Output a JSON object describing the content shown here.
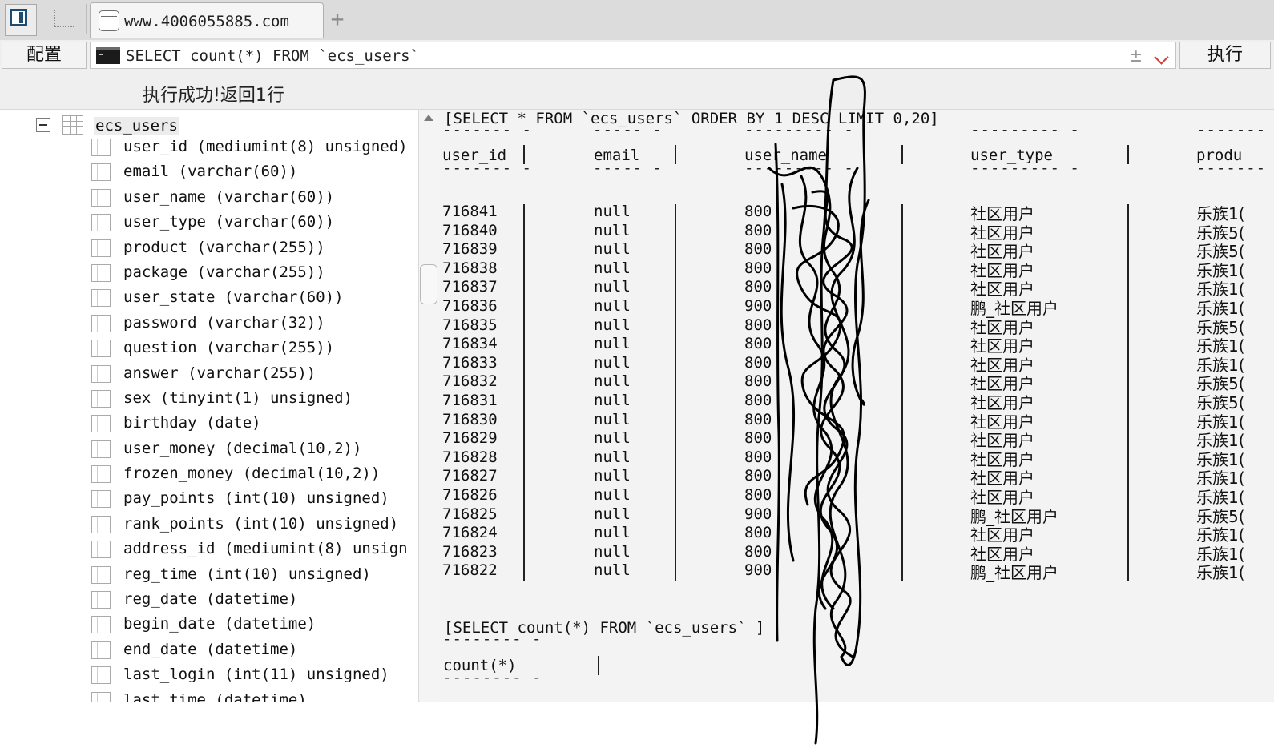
{
  "tabbar": {
    "tab_title": "www.4006055885.com",
    "add_tab": "+"
  },
  "querybar": {
    "config_label": "配置",
    "sql_text": "SELECT count(*) FROM `ecs_users`",
    "plus_minus": "±",
    "exec_label": "执行"
  },
  "status": {
    "message": "执行成功!返回1行"
  },
  "tree": {
    "table_name": "ecs_users",
    "columns": [
      "user_id (mediumint(8) unsigned)",
      "email (varchar(60))",
      "user_name (varchar(60))",
      "user_type (varchar(60))",
      "product (varchar(255))",
      "package (varchar(255))",
      "user_state (varchar(60))",
      "password (varchar(32))",
      "question (varchar(255))",
      "answer (varchar(255))",
      "sex (tinyint(1) unsigned)",
      "birthday (date)",
      "user_money (decimal(10,2))",
      "frozen_money (decimal(10,2))",
      "pay_points (int(10) unsigned)",
      "rank_points (int(10) unsigned)",
      "address_id (mediumint(8) unsign",
      "reg_time (int(10) unsigned)",
      "reg_date (datetime)",
      "begin_date (datetime)",
      "end_date (datetime)",
      "last_login (int(11) unsigned)",
      "last_time (datetime)"
    ]
  },
  "results": {
    "query1": "[SELECT * FROM `ecs_users` ORDER BY 1 DESC LIMIT 0,20]",
    "headers": [
      "user_id",
      "email",
      "user_name",
      "user_type",
      "produ"
    ],
    "rows": [
      {
        "user_id": "716841",
        "email": "null",
        "user_name": "800",
        "user_type": "社区用户",
        "product": "乐族1("
      },
      {
        "user_id": "716840",
        "email": "null",
        "user_name": "800",
        "user_type": "社区用户",
        "product": "乐族5("
      },
      {
        "user_id": "716839",
        "email": "null",
        "user_name": "800",
        "user_type": "社区用户",
        "product": "乐族5("
      },
      {
        "user_id": "716838",
        "email": "null",
        "user_name": "800",
        "user_type": "社区用户",
        "product": "乐族1("
      },
      {
        "user_id": "716837",
        "email": "null",
        "user_name": "800",
        "user_type": "社区用户",
        "product": "乐族1("
      },
      {
        "user_id": "716836",
        "email": "null",
        "user_name": "900",
        "user_type": "鹏_社区用户",
        "product": "乐族1("
      },
      {
        "user_id": "716835",
        "email": "null",
        "user_name": "800",
        "user_type": "社区用户",
        "product": "乐族5("
      },
      {
        "user_id": "716834",
        "email": "null",
        "user_name": "800",
        "user_type": "社区用户",
        "product": "乐族1("
      },
      {
        "user_id": "716833",
        "email": "null",
        "user_name": "800",
        "user_type": "社区用户",
        "product": "乐族1("
      },
      {
        "user_id": "716832",
        "email": "null",
        "user_name": "800",
        "user_type": "社区用户",
        "product": "乐族5("
      },
      {
        "user_id": "716831",
        "email": "null",
        "user_name": "800",
        "user_type": "社区用户",
        "product": "乐族5("
      },
      {
        "user_id": "716830",
        "email": "null",
        "user_name": "800",
        "user_type": "社区用户",
        "product": "乐族1("
      },
      {
        "user_id": "716829",
        "email": "null",
        "user_name": "800",
        "user_type": "社区用户",
        "product": "乐族1("
      },
      {
        "user_id": "716828",
        "email": "null",
        "user_name": "800",
        "user_type": "社区用户",
        "product": "乐族1("
      },
      {
        "user_id": "716827",
        "email": "null",
        "user_name": "800",
        "user_type": "社区用户",
        "product": "乐族1("
      },
      {
        "user_id": "716826",
        "email": "null",
        "user_name": "800",
        "user_type": "社区用户",
        "product": "乐族1("
      },
      {
        "user_id": "716825",
        "email": "null",
        "user_name": "900",
        "user_type": "鹏_社区用户",
        "product": "乐族5("
      },
      {
        "user_id": "716824",
        "email": "null",
        "user_name": "800",
        "user_type": "社区用户",
        "product": "乐族1("
      },
      {
        "user_id": "716823",
        "email": "null",
        "user_name": "800",
        "user_type": "社区用户",
        "product": "乐族1("
      },
      {
        "user_id": "716822",
        "email": "null",
        "user_name": "900",
        "user_type": "鹏_社区用户",
        "product": "乐族1("
      }
    ],
    "query2": "[SELECT count(*) FROM `ecs_users` ]",
    "count_header": "count(*)"
  }
}
